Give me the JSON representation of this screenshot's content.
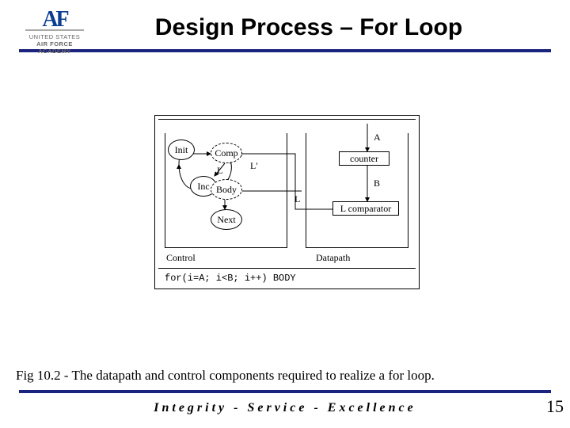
{
  "logo": {
    "monogram": "AF",
    "line1": "UNITED STATES",
    "line2": "AIR FORCE",
    "line3": "ACADEMY"
  },
  "title": "Design Process – For Loop",
  "diagram": {
    "nodes": {
      "init": "Init",
      "comp": "Comp",
      "inc": "Inc",
      "body": "Body",
      "next": "Next"
    },
    "boxes": {
      "counter": "counter",
      "comparator": "L comparator"
    },
    "labels": {
      "control": "Control",
      "datapath": "Datapath",
      "Lprime": "L'",
      "L_left": "L",
      "L_right": "L",
      "A": "A",
      "B": "B"
    },
    "code": "for(i=A; i<B; i++) BODY"
  },
  "caption": "Fig 10.2 - The datapath and control components required to realize a for loop.",
  "footer": "Integrity - Service - Excellence",
  "page": "15"
}
